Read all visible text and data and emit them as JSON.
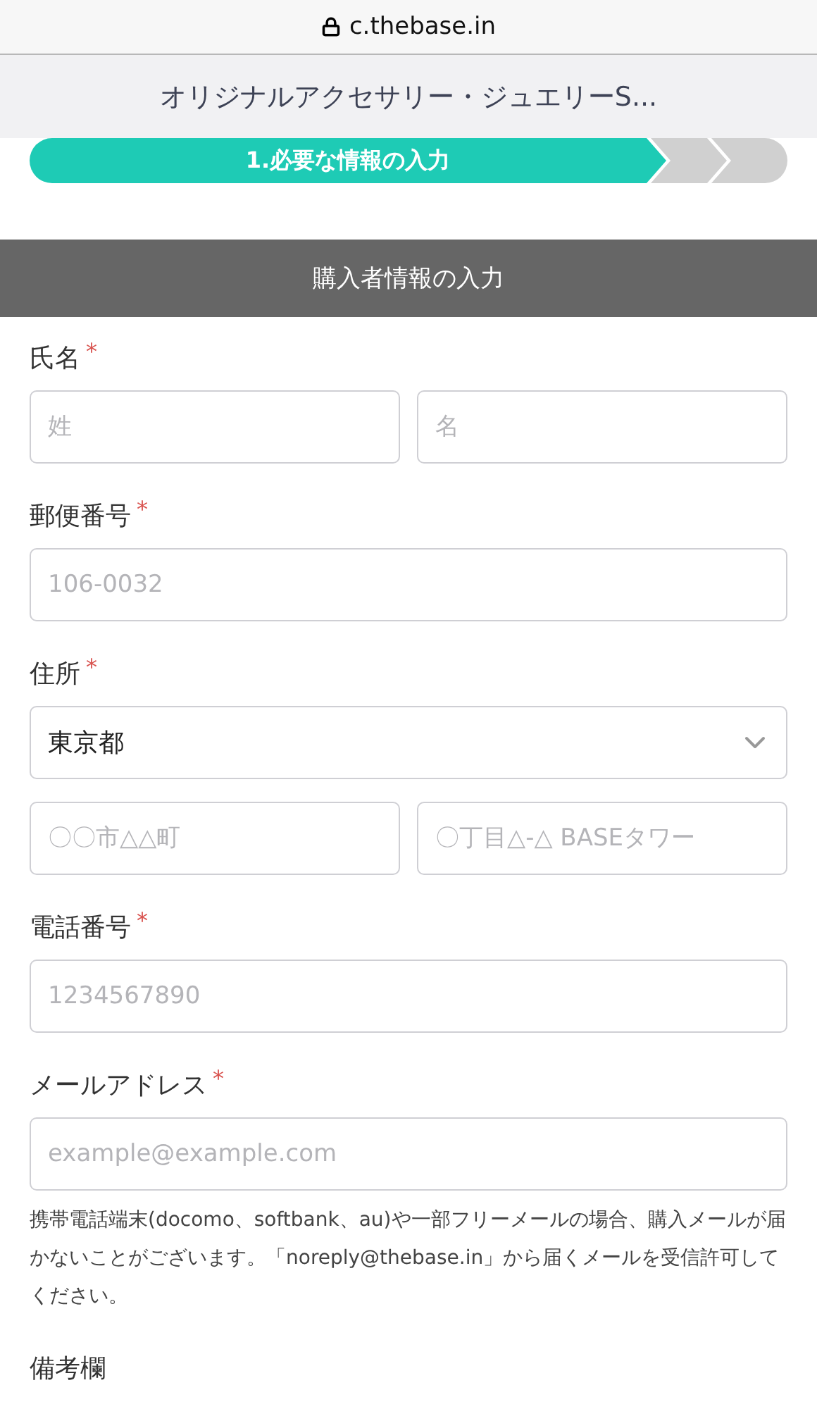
{
  "address_bar": {
    "url": "c.thebase.in"
  },
  "header": {
    "title": "オリジナルアクセサリー・ジュエリーS..."
  },
  "progress": {
    "steps": [
      {
        "label": "1.必要な情報の入力",
        "selected": true
      },
      {
        "selected": false
      },
      {
        "selected": false
      }
    ]
  },
  "section": {
    "title": "購入者情報の入力"
  },
  "fields": [
    {
      "label": "氏名",
      "required_mark": "*",
      "inputs": [
        {
          "kind": "text",
          "placeholder": "姓"
        },
        {
          "kind": "text",
          "placeholder": "名"
        }
      ]
    },
    {
      "label": "郵便番号",
      "required_mark": "*",
      "inputs": [
        {
          "kind": "text",
          "placeholder": "106-0032"
        }
      ]
    },
    {
      "label": "住所",
      "required_mark": "*",
      "inputs": [
        {
          "kind": "select",
          "value": "東京都"
        }
      ]
    },
    {
      "inputs": [
        {
          "kind": "text",
          "placeholder": "〇〇市△△町"
        },
        {
          "kind": "text",
          "placeholder": "〇丁目△-△ BASEタワー"
        }
      ]
    },
    {
      "label": "電話番号",
      "required_mark": "*",
      "inputs": [
        {
          "kind": "text",
          "placeholder": "1234567890"
        }
      ]
    },
    {
      "label": "メールアドレス",
      "required_mark": "*",
      "inputs": [
        {
          "kind": "text",
          "placeholder": "example@example.com"
        }
      ],
      "note": "携帯電話端末(docomo、softbank、au)や一部フリーメールの場合、購入メールが届かないことがございます。「noreply@thebase.in」から届くメールを受信許可してください。"
    },
    {
      "label": "備考欄"
    }
  ]
}
